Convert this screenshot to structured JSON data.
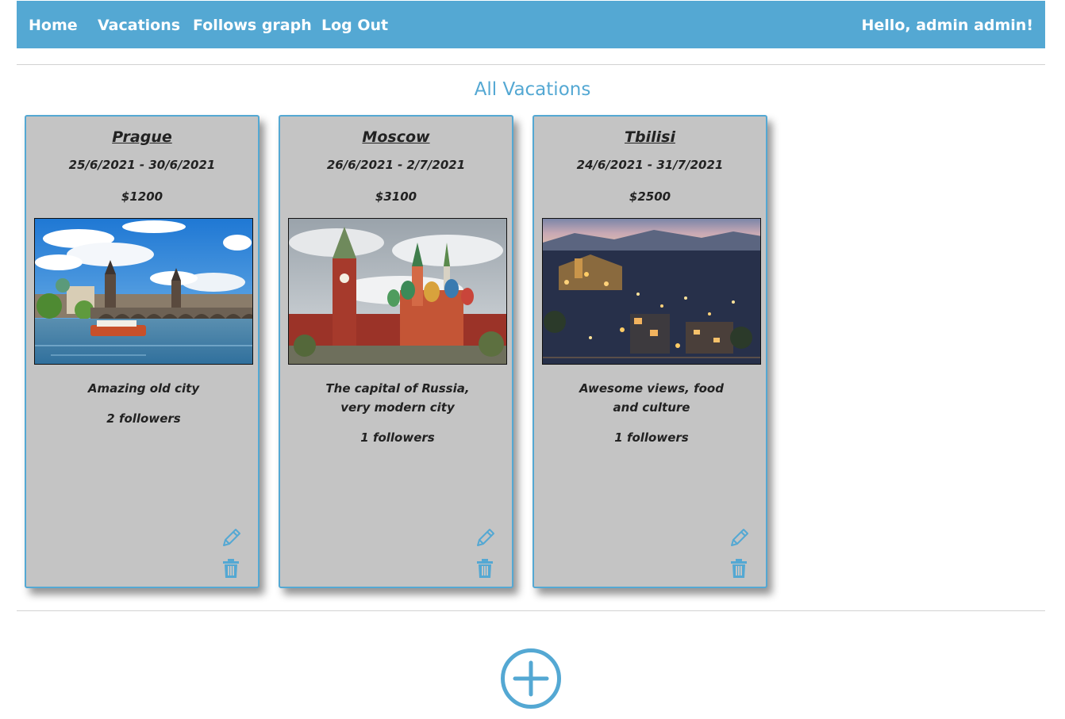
{
  "navbar": {
    "items": [
      {
        "label": "Home"
      },
      {
        "label": "Vacations"
      },
      {
        "label": "Follows graph"
      },
      {
        "label": "Log Out"
      }
    ],
    "greeting": "Hello, admin admin!"
  },
  "page": {
    "title": "All Vacations"
  },
  "vacations": [
    {
      "name": "Prague",
      "dates": "25/6/2021 - 30/6/2021",
      "price": "$1200",
      "description": "Amazing old city",
      "followers": "2 followers"
    },
    {
      "name": "Moscow",
      "dates": "26/6/2021 - 2/7/2021",
      "price": "$3100",
      "description": "The capital of Russia, very modern city",
      "followers": "1 followers"
    },
    {
      "name": "Tbilisi",
      "dates": "24/6/2021 - 31/7/2021",
      "price": "$2500",
      "description": "Awesome views, food and culture",
      "followers": "1 followers"
    }
  ],
  "colors": {
    "accent": "#54a8d3",
    "card_background": "#c4c4c4",
    "text": "#222222"
  },
  "icons": {
    "edit": "pencil-icon",
    "delete": "trash-icon",
    "add": "plus-circle-icon"
  }
}
